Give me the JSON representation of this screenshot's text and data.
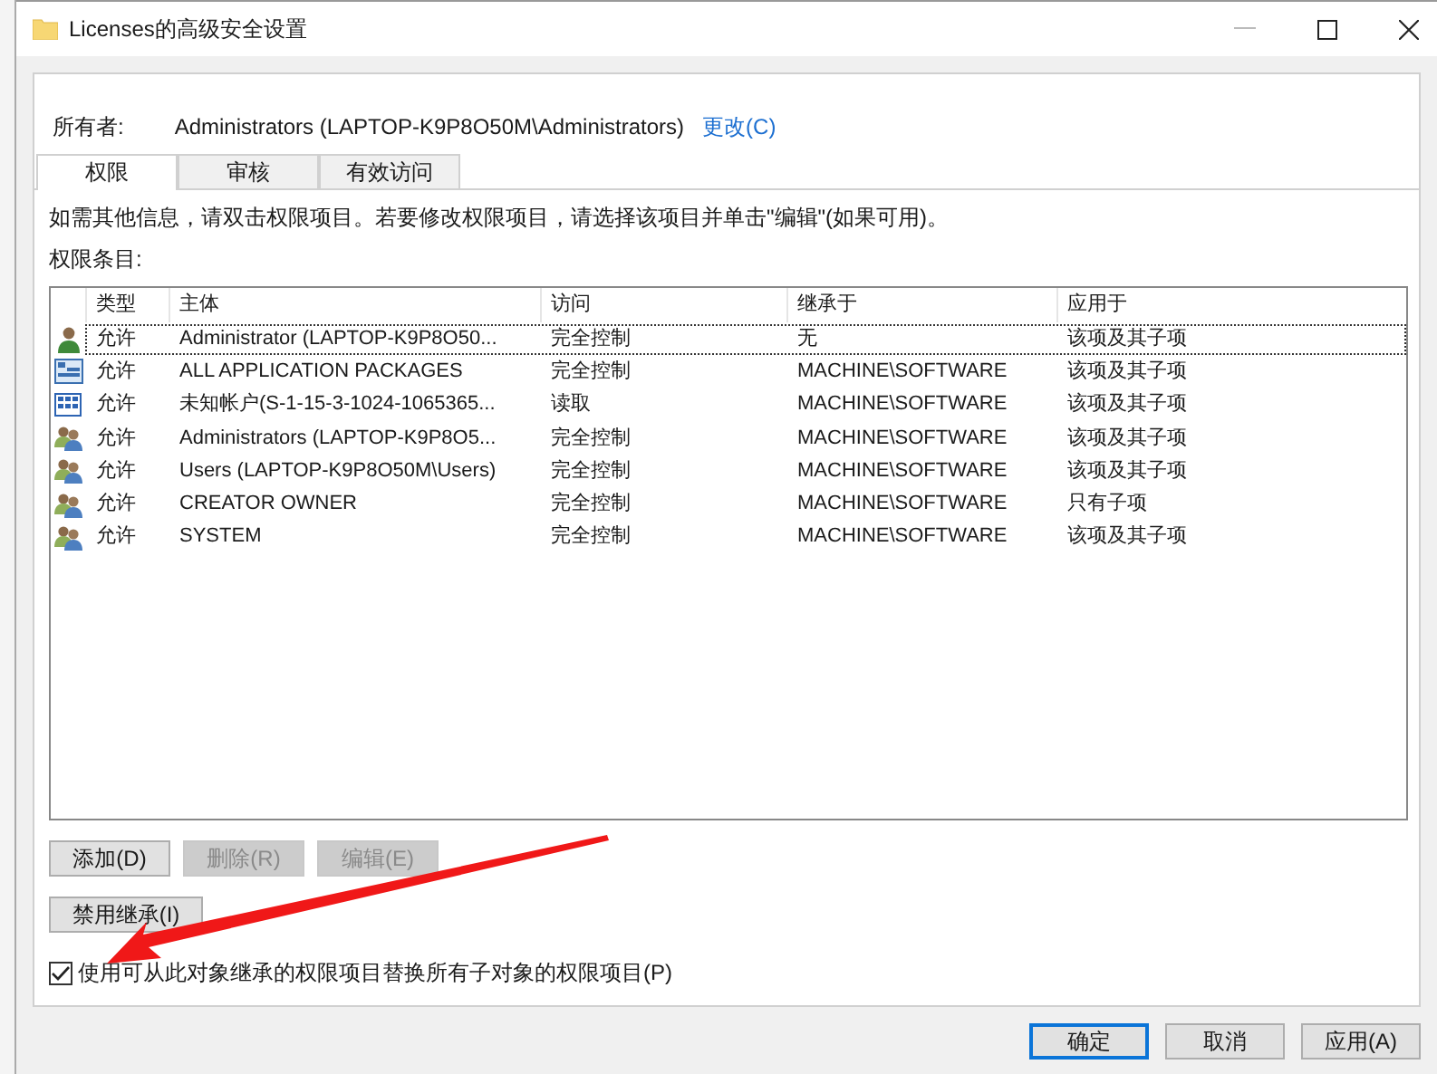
{
  "window": {
    "title": "Licenses的高级安全设置"
  },
  "owner": {
    "label": "所有者:",
    "value": "Administrators (LAPTOP-K9P8O50M\\Administrators)",
    "change_link": "更改(C)"
  },
  "tabs": [
    {
      "label": "权限",
      "selected": true
    },
    {
      "label": "审核",
      "selected": false
    },
    {
      "label": "有效访问",
      "selected": false
    }
  ],
  "instruction": "如需其他信息，请双击权限项目。若要修改权限项目，请选择该项目并单击\"编辑\"(如果可用)。",
  "list_label": "权限条目:",
  "table": {
    "columns": [
      "类型",
      "主体",
      "访问",
      "继承于",
      "应用于"
    ],
    "rows": [
      {
        "kind": "user",
        "focused": true,
        "cells": [
          "允许",
          "Administrator (LAPTOP-K9P8O50...",
          "完全控制",
          "无",
          "该项及其子项"
        ]
      },
      {
        "kind": "package",
        "focused": false,
        "cells": [
          "允许",
          "ALL APPLICATION PACKAGES",
          "完全控制",
          "MACHINE\\SOFTWARE",
          "该项及其子项"
        ]
      },
      {
        "kind": "unknown",
        "focused": false,
        "cells": [
          "允许",
          "未知帐户(S-1-15-3-1024-1065365...",
          "读取",
          "MACHINE\\SOFTWARE",
          "该项及其子项"
        ]
      },
      {
        "kind": "group",
        "focused": false,
        "cells": [
          "允许",
          "Administrators (LAPTOP-K9P8O5...",
          "完全控制",
          "MACHINE\\SOFTWARE",
          "该项及其子项"
        ]
      },
      {
        "kind": "group",
        "focused": false,
        "cells": [
          "允许",
          "Users (LAPTOP-K9P8O50M\\Users)",
          "完全控制",
          "MACHINE\\SOFTWARE",
          "该项及其子项"
        ]
      },
      {
        "kind": "group",
        "focused": false,
        "cells": [
          "允许",
          "CREATOR OWNER",
          "完全控制",
          "MACHINE\\SOFTWARE",
          "只有子项"
        ]
      },
      {
        "kind": "group",
        "focused": false,
        "cells": [
          "允许",
          "SYSTEM",
          "完全控制",
          "MACHINE\\SOFTWARE",
          "该项及其子项"
        ]
      }
    ]
  },
  "entry_buttons": [
    {
      "label": "添加(D)",
      "disabled": false
    },
    {
      "label": "删除(R)",
      "disabled": true
    },
    {
      "label": "编辑(E)",
      "disabled": true
    }
  ],
  "inheritance_button": "禁用继承(I)",
  "replace_checkbox": {
    "label": "使用可从此对象继承的权限项目替换所有子对象的权限项目(P)",
    "checked": true
  },
  "dialog_buttons": [
    {
      "label": "确定",
      "default": true,
      "disabled": false
    },
    {
      "label": "取消",
      "default": false,
      "disabled": false
    },
    {
      "label": "应用(A)",
      "default": false,
      "disabled": false
    }
  ]
}
